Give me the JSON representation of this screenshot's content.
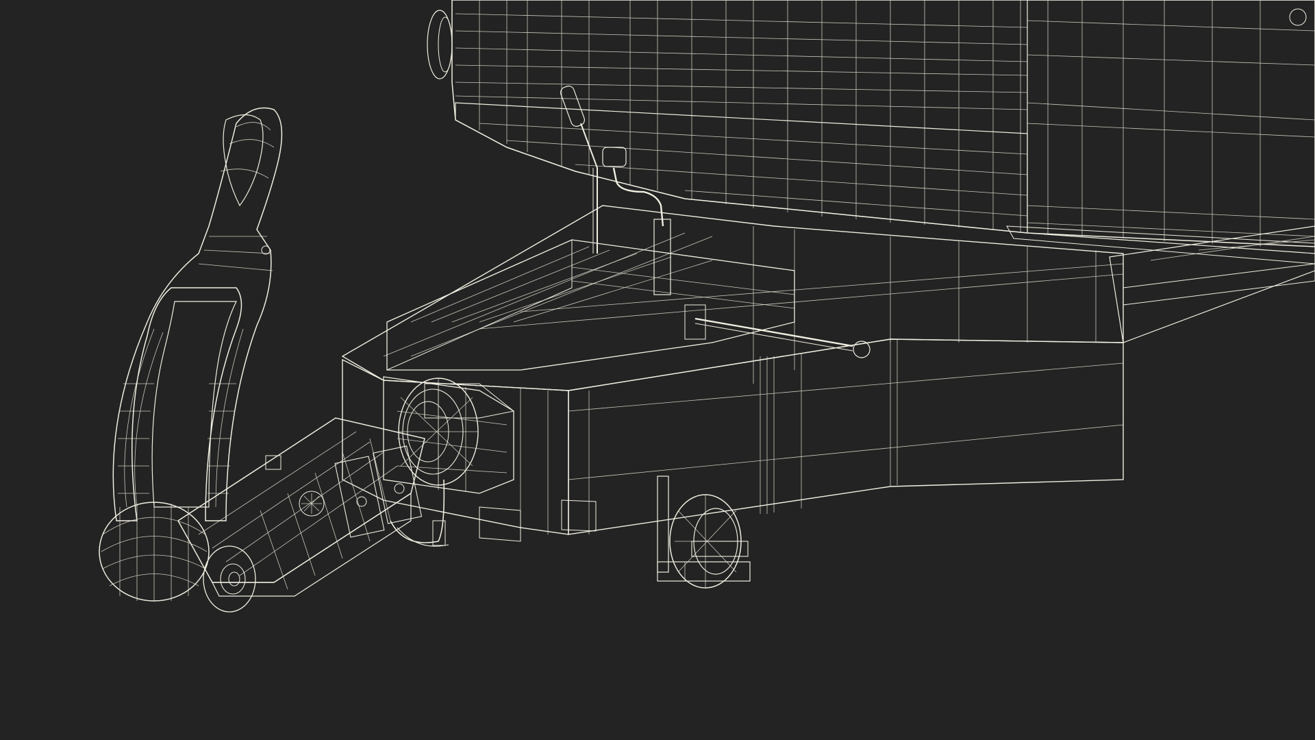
{
  "scene": {
    "view": "wireframe-render",
    "subject": "trailer-drawbar-with-hitch",
    "colors": {
      "background": "#232323",
      "mesh_fill_dark": "#5a5c4c",
      "mesh_fill_mid": "#6f7161",
      "mesh_fill_light": "#7d7f6e",
      "wire": "#f1efe2"
    }
  }
}
